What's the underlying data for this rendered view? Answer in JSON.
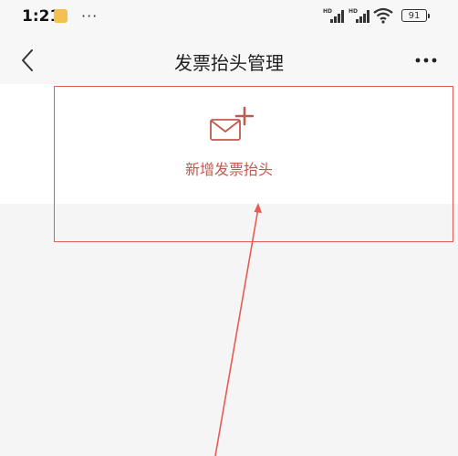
{
  "status_bar": {
    "time": "1:21",
    "more": "···",
    "battery": "91",
    "notification_icon": "notes-app-icon",
    "signal_icons": [
      "hd-signal-icon",
      "hd-signal-icon"
    ],
    "wifi_icon": "wifi-icon"
  },
  "nav": {
    "title": "发票抬头管理",
    "back_icon": "chevron-left-icon",
    "menu_icon": "more-horizontal-icon"
  },
  "add_card": {
    "label": "新增发票抬头",
    "icon": "envelope-plus-icon"
  },
  "colors": {
    "accent": "#c05a4e",
    "annotation": "#e85b55",
    "background": "#f5f5f5",
    "card": "#ffffff"
  }
}
